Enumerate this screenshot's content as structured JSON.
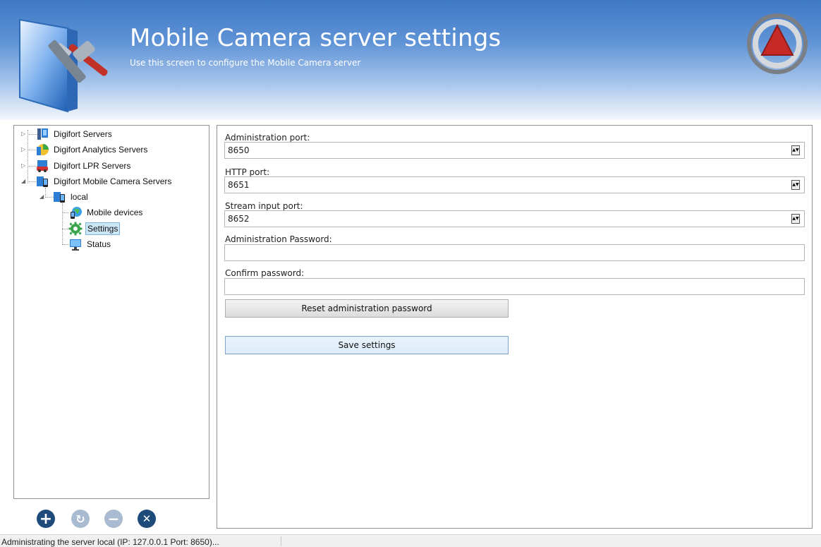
{
  "header": {
    "title": "Mobile Camera server settings",
    "subtitle": "Use this screen to configure the Mobile Camera server",
    "logo_icon": "server-tools-icon",
    "emblem_icon": "digifort-emblem-icon"
  },
  "tree": {
    "items": [
      {
        "label": "Digifort Servers",
        "icon": "server-icon"
      },
      {
        "label": "Digifort Analytics Servers",
        "icon": "analytics-server-icon"
      },
      {
        "label": "Digifort LPR Servers",
        "icon": "lpr-server-icon"
      },
      {
        "label": "Digifort Mobile Camera Servers",
        "icon": "mobile-camera-server-icon"
      },
      {
        "label": "local",
        "icon": "server-node-icon"
      },
      {
        "label": "Mobile devices",
        "icon": "mobile-devices-icon"
      },
      {
        "label": "Settings",
        "icon": "gear-icon"
      },
      {
        "label": "Status",
        "icon": "monitor-icon"
      }
    ],
    "selected": "Settings"
  },
  "toolbar": {
    "add_icon": "plus-icon",
    "refresh_icon": "refresh-icon",
    "remove_icon": "minus-icon",
    "close_icon": "close-icon"
  },
  "settings": {
    "admin_port_label": "Administration port:",
    "admin_port_value": "8650",
    "http_port_label": "HTTP port:",
    "http_port_value": "8651",
    "stream_port_label": "Stream input port:",
    "stream_port_value": "8652",
    "admin_password_label": "Administration Password:",
    "admin_password_value": "",
    "confirm_password_label": "Confirm password:",
    "confirm_password_value": "",
    "reset_button": "Reset administration password",
    "save_button": "Save settings"
  },
  "status_bar": {
    "text": "Administrating the server local (IP: 127.0.0.1 Port: 8650)..."
  },
  "colors": {
    "header_top": "#3f78c5",
    "header_bottom": "#f3f7fc",
    "selection": "#cde6f7",
    "toolbar_dark": "#1f4b7a",
    "toolbar_light": "#a9bbd0"
  }
}
